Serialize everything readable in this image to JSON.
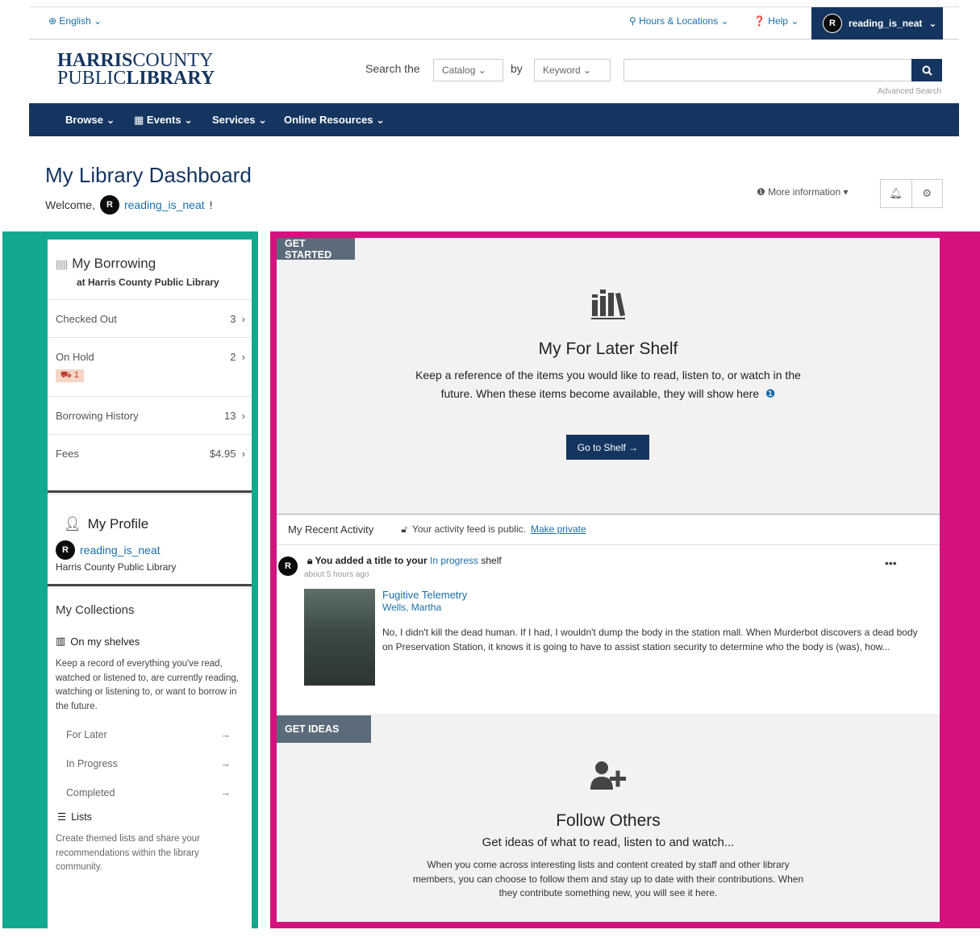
{
  "utility": {
    "language": "English",
    "hours": "Hours & Locations",
    "help": "Help",
    "user": {
      "avatar_letter": "R",
      "name": "reading_is_neat"
    }
  },
  "header": {
    "logo_line1_bold": "HARRIS",
    "logo_line1_light": "COUNTY",
    "logo_line2_light": "PUBLIC",
    "logo_line2_bold": "LIBRARY",
    "search_the": "Search the",
    "catalog_select": "Catalog",
    "by_label": "by",
    "keyword_select": "Keyword",
    "advanced_search": "Advanced Search"
  },
  "nav": {
    "items": [
      "Browse",
      "Events",
      "Services",
      "Online Resources"
    ]
  },
  "page": {
    "title": "My Library Dashboard",
    "welcome": "Welcome,",
    "username": "reading_is_neat",
    "exclaim": "!",
    "more_info": "More information"
  },
  "borrowing": {
    "title": "My Borrowing",
    "subtitle": "at Harris County Public Library",
    "rows": [
      {
        "label": "Checked Out",
        "value": "3"
      },
      {
        "label": "On Hold",
        "value": "2",
        "badge": "1"
      },
      {
        "label": "Borrowing History",
        "value": "13"
      },
      {
        "label": "Fees",
        "value": "$4.95"
      }
    ]
  },
  "profile": {
    "title": "My Profile",
    "avatar_letter": "R",
    "username": "reading_is_neat",
    "library": "Harris County Public Library"
  },
  "collections": {
    "title": "My Collections",
    "shelves_title": "On my shelves",
    "shelves_desc": "Keep a record of everything you've read, watched or listened to, are currently reading, watching or listening to, or want to borrow in the future.",
    "links": [
      "For Later",
      "In Progress",
      "Completed"
    ],
    "lists_title": "Lists",
    "lists_desc": "Create themed lists and share your recommendations within the library community."
  },
  "get_started": {
    "tag": "GET STARTED",
    "title": "My For Later Shelf",
    "desc": "Keep a reference of the items you would like to read, listen to, or watch in the future. When these items become available, they will show here",
    "button": "Go to Shelf"
  },
  "activity": {
    "title": "My Recent Activity",
    "public_text": "Your activity feed is public.",
    "make_private": "Make private",
    "avatar_letter": "R",
    "action_prefix": "You added a title to your",
    "action_link": "In progress",
    "action_suffix": "shelf",
    "time": "about 5 hours ago",
    "more": "•••",
    "book_title": "Fugitive Telemetry",
    "book_author": "Wells, Martha",
    "book_desc": "No, I didn't kill the dead human. If I had, I wouldn't dump the body in the station mall. When Murderbot discovers a dead body on Preservation Station, it knows it is going to have to assist station security to determine who the body is (was), how..."
  },
  "get_ideas": {
    "tag": "GET IDEAS",
    "title": "Follow Others",
    "subtitle": "Get ideas of what to read, listen to and watch...",
    "desc": "When you come across interesting lists and content created by staff and other library members, you can choose to follow them and stay up to date with their contributions. When they contribute something new, you will see it here."
  },
  "colors": {
    "brand": "#14355f",
    "link": "#1a6fa8",
    "left_highlight": "#13a98f",
    "right_highlight": "#d4117f",
    "tag": "#5b6b7a"
  }
}
